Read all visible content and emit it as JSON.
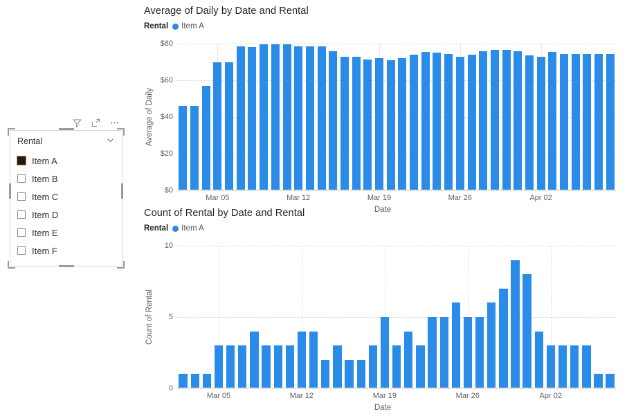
{
  "slicer": {
    "header": "Rental",
    "chevron": "chevron-down-icon",
    "toolbar": [
      {
        "name": "filter-icon",
        "label": "Filter"
      },
      {
        "name": "focus-mode-icon",
        "label": "Focus mode"
      },
      {
        "name": "more-options-icon",
        "label": "More options"
      }
    ],
    "items": [
      {
        "label": "Item A",
        "checked": true
      },
      {
        "label": "Item B",
        "checked": false
      },
      {
        "label": "Item C",
        "checked": false
      },
      {
        "label": "Item D",
        "checked": false
      },
      {
        "label": "Item E",
        "checked": false
      },
      {
        "label": "Item F",
        "checked": false
      }
    ],
    "selected_outline_color": "#e08a1e",
    "checked_fill_color": "#1b1b1b"
  },
  "colors": {
    "bar": "#2a8ce8",
    "legend_dot": "#2a8ce8",
    "grid": "#d0d0d0",
    "axis_text": "#605e5c",
    "title_text": "#252423"
  },
  "chart_data": [
    {
      "id": "average-of-daily",
      "type": "bar",
      "title": "Average of Daily by Date and Rental",
      "legend_title": "Rental",
      "legend": [
        "Item A"
      ],
      "legend_position": "top-left",
      "xlabel": "Date",
      "ylabel": "Average of Daily",
      "ylim": [
        0,
        80
      ],
      "yticks": [
        0,
        20,
        40,
        60,
        80
      ],
      "ytick_labels": [
        "$0",
        "$20",
        "$40",
        "$60",
        "$80"
      ],
      "grid": true,
      "xtick_labels": [
        "Mar 05",
        "Mar 12",
        "Mar 19",
        "Mar 26",
        "Apr 02"
      ],
      "xtick_indices": [
        3,
        10,
        17,
        24,
        31
      ],
      "categories": [
        "Mar 02",
        "Mar 03",
        "Mar 04",
        "Mar 05",
        "Mar 06",
        "Mar 07",
        "Mar 08",
        "Mar 09",
        "Mar 10",
        "Mar 11",
        "Mar 12",
        "Mar 13",
        "Mar 14",
        "Mar 15",
        "Mar 16",
        "Mar 17",
        "Mar 18",
        "Mar 19",
        "Mar 20",
        "Mar 21",
        "Mar 22",
        "Mar 23",
        "Mar 24",
        "Mar 25",
        "Mar 26",
        "Mar 27",
        "Mar 28",
        "Mar 29",
        "Mar 30",
        "Mar 31",
        "Apr 01",
        "Apr 02",
        "Apr 03",
        "Apr 04",
        "Apr 05",
        "Apr 06",
        "Apr 07",
        "Apr 08"
      ],
      "values": [
        46,
        46,
        57,
        70,
        70,
        78.5,
        78,
        79.5,
        79.5,
        79.5,
        78.5,
        78.5,
        78.5,
        76,
        73,
        73,
        71.5,
        72,
        71,
        72,
        74,
        75.5,
        75,
        74.5,
        73,
        74,
        76,
        76.5,
        76.5,
        76,
        73.5,
        73,
        75.5,
        74.5,
        74.5,
        74.5,
        74.5,
        74.5
      ]
    },
    {
      "id": "count-of-rental",
      "type": "bar",
      "title": "Count of Rental by Date and Rental",
      "legend_title": "Rental",
      "legend": [
        "Item A"
      ],
      "legend_position": "top-left",
      "xlabel": "Date",
      "ylabel": "Count of Rental",
      "ylim": [
        0,
        10
      ],
      "yticks": [
        0,
        5,
        10
      ],
      "ytick_labels": [
        "0",
        "5",
        "10"
      ],
      "grid": true,
      "xtick_labels": [
        "Mar 05",
        "Mar 12",
        "Mar 19",
        "Mar 26",
        "Apr 02"
      ],
      "xtick_indices": [
        3,
        10,
        17,
        24,
        31
      ],
      "categories": [
        "Mar 02",
        "Mar 03",
        "Mar 04",
        "Mar 05",
        "Mar 06",
        "Mar 07",
        "Mar 08",
        "Mar 09",
        "Mar 10",
        "Mar 11",
        "Mar 12",
        "Mar 13",
        "Mar 14",
        "Mar 15",
        "Mar 16",
        "Mar 17",
        "Mar 18",
        "Mar 19",
        "Mar 20",
        "Mar 21",
        "Mar 22",
        "Mar 23",
        "Mar 24",
        "Mar 25",
        "Mar 26",
        "Mar 27",
        "Mar 28",
        "Mar 29",
        "Mar 30",
        "Mar 31",
        "Apr 01",
        "Apr 02",
        "Apr 03",
        "Apr 04",
        "Apr 05",
        "Apr 06",
        "Apr 07",
        "Apr 08"
      ],
      "values": [
        1,
        1,
        1,
        3,
        3,
        3,
        4,
        3,
        3,
        3,
        4,
        4,
        2,
        3,
        2,
        2,
        3,
        5,
        3,
        4,
        3,
        5,
        5,
        6,
        5,
        5,
        6,
        7,
        9,
        8,
        4,
        3,
        3,
        3,
        3,
        1,
        1
      ]
    }
  ]
}
